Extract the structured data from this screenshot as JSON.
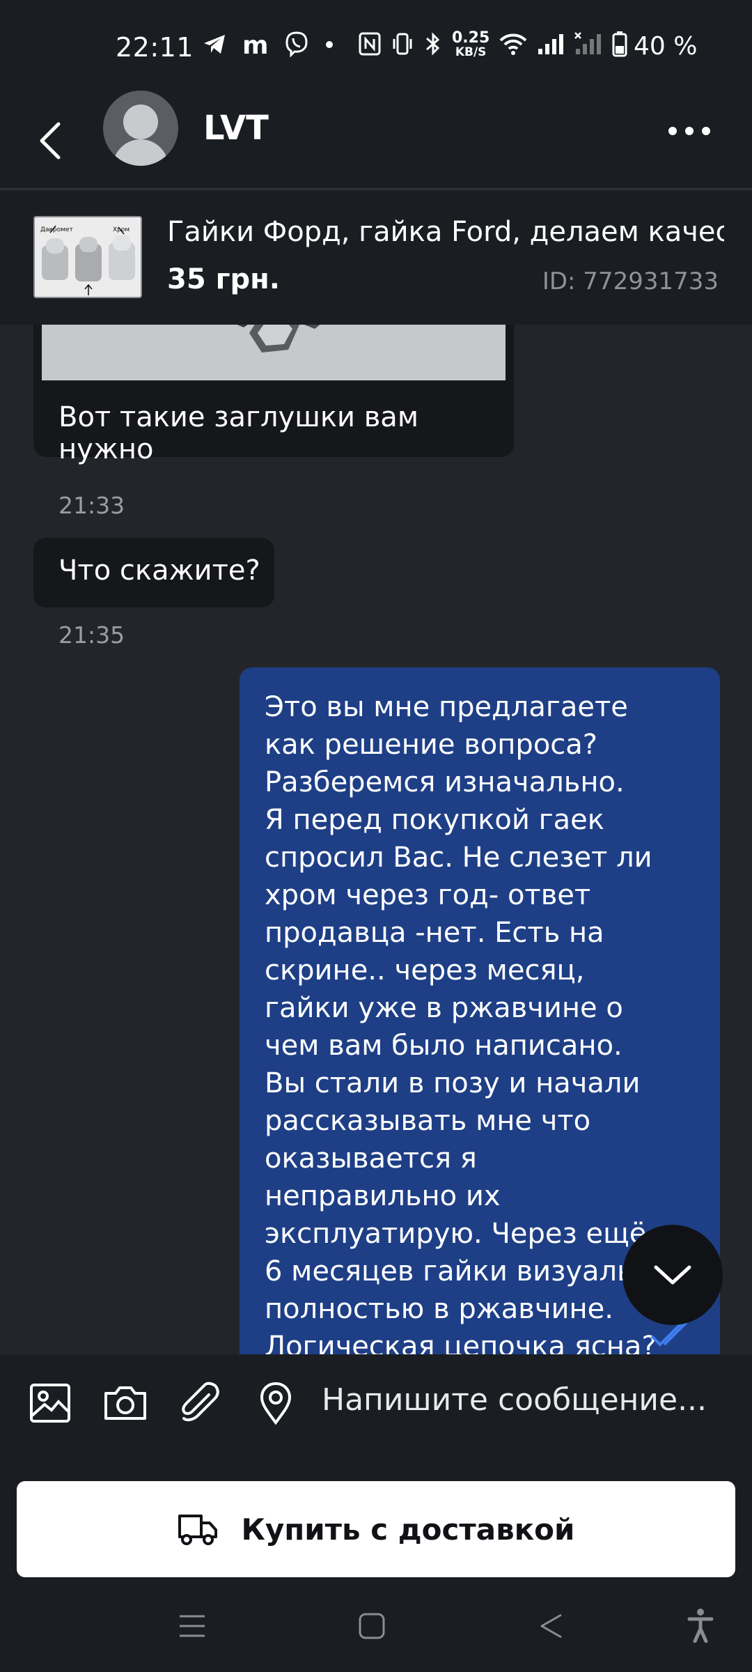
{
  "status_bar": {
    "time": "22:11",
    "net_speed_value": "0.25",
    "net_speed_unit": "KB/S",
    "battery": "40 %",
    "icons": [
      "telegram-icon",
      "m-icon",
      "viber-icon",
      "dot-icon",
      "nfc-icon",
      "vibrate-icon",
      "bluetooth-icon",
      "wifi-icon",
      "signal-icon",
      "signal-x-icon",
      "battery-icon"
    ]
  },
  "header": {
    "contact_name": "LVT"
  },
  "product": {
    "title": "Гайки Форд, гайка Ford, делаем качес...",
    "price": "35 грн.",
    "id": "ID: 772931733",
    "thumb_label_left": "Дакромет",
    "thumb_label_right": "Хром"
  },
  "messages": [
    {
      "direction": "in",
      "type": "image",
      "caption": "Вот такие заглушки вам нужно",
      "time": "21:33"
    },
    {
      "direction": "in",
      "type": "text",
      "text": "Что скажите?",
      "time": "21:35"
    },
    {
      "direction": "out",
      "type": "text",
      "text": "Это вы мне предлагаете\nкак решение вопроса?\nРазберемся изначально.\nЯ перед покупкой гаек\nспросил Вас. Не слезет ли\nхром через год- ответ\nпродавца -нет. Есть на\nскрине.. через месяц,\nгайки уже в ржавчине о\nчем вам было написано.\nВы стали в позу и начали\nрассказывать мне что\nоказывается я\nнеправильно их\nэксплуатирую. Через ещё\n6 месяцев гайки визуально\nполностью в ржавчине.\nЛогическая цепочка ясна?",
      "read": true
    }
  ],
  "composer": {
    "placeholder": "Напишите сообщение..."
  },
  "buy_button": {
    "label": "Купить с доставкой"
  },
  "colors": {
    "background": "#23252b",
    "bar": "#1a1d22",
    "incoming_bubble": "#15171b",
    "outgoing_bubble": "#1e3f86",
    "read_tick": "#3f7df0"
  }
}
